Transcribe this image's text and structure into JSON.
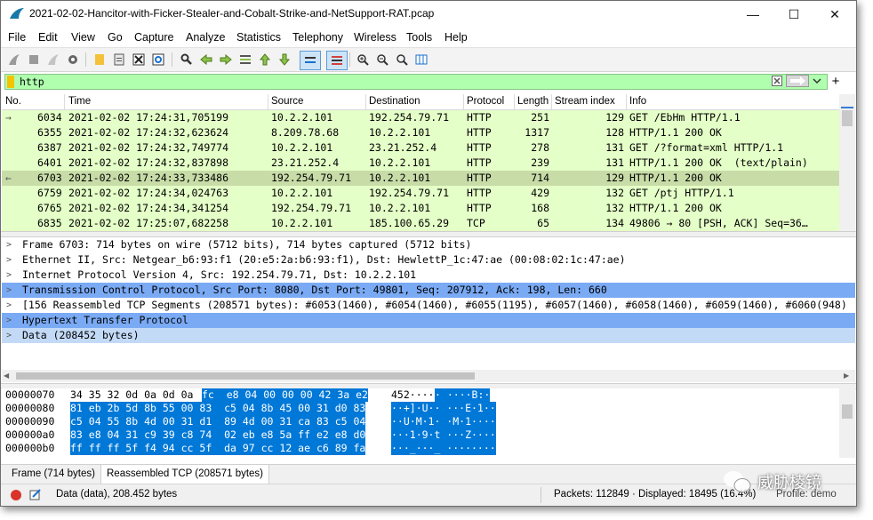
{
  "window": {
    "title": "2021-02-02-Hancitor-with-Ficker-Stealer-and-Cobalt-Strike-and-NetSupport-RAT.pcap",
    "minimize": "—",
    "maximize": "☐",
    "close": "✕"
  },
  "menu": [
    "File",
    "Edit",
    "View",
    "Go",
    "Capture",
    "Analyze",
    "Statistics",
    "Telephony",
    "Wireless",
    "Tools",
    "Help"
  ],
  "filter": {
    "value": "http",
    "plus": "+"
  },
  "columns": [
    "No.",
    "Time",
    "Source",
    "Destination",
    "Protocol",
    "Length",
    "Stream index",
    "Info"
  ],
  "packets": [
    {
      "no": "6034",
      "time": "2021-02-02 17:24:31,705199",
      "src": "10.2.2.101",
      "dst": "192.254.79.71",
      "proto": "HTTP",
      "len": "251",
      "stream": "129",
      "info": "GET /EbHm HTTP/1.1",
      "bg": "#e4ffc7",
      "marker": "→"
    },
    {
      "no": "6355",
      "time": "2021-02-02 17:24:32,623624",
      "src": "8.209.78.68",
      "dst": "10.2.2.101",
      "proto": "HTTP",
      "len": "1317",
      "stream": "128",
      "info": "HTTP/1.1 200 OK",
      "bg": "#e4ffc7",
      "marker": ""
    },
    {
      "no": "6387",
      "time": "2021-02-02 17:24:32,749774",
      "src": "10.2.2.101",
      "dst": "23.21.252.4",
      "proto": "HTTP",
      "len": "278",
      "stream": "131",
      "info": "GET /?format=xml HTTP/1.1",
      "bg": "#e4ffc7",
      "marker": ""
    },
    {
      "no": "6401",
      "time": "2021-02-02 17:24:32,837898",
      "src": "23.21.252.4",
      "dst": "10.2.2.101",
      "proto": "HTTP",
      "len": "239",
      "stream": "131",
      "info": "HTTP/1.1 200 OK  (text/plain)",
      "bg": "#e4ffc7",
      "marker": ""
    },
    {
      "no": "6703",
      "time": "2021-02-02 17:24:33,733486",
      "src": "192.254.79.71",
      "dst": "10.2.2.101",
      "proto": "HTTP",
      "len": "714",
      "stream": "129",
      "info": "HTTP/1.1 200 OK",
      "bg": "#c8dca8",
      "marker": "←"
    },
    {
      "no": "6759",
      "time": "2021-02-02 17:24:34,024763",
      "src": "10.2.2.101",
      "dst": "192.254.79.71",
      "proto": "HTTP",
      "len": "429",
      "stream": "132",
      "info": "GET /ptj HTTP/1.1",
      "bg": "#e4ffc7",
      "marker": ""
    },
    {
      "no": "6765",
      "time": "2021-02-02 17:24:34,341254",
      "src": "192.254.79.71",
      "dst": "10.2.2.101",
      "proto": "HTTP",
      "len": "168",
      "stream": "132",
      "info": "HTTP/1.1 200 OK",
      "bg": "#e4ffc7",
      "marker": ""
    },
    {
      "no": "6835",
      "time": "2021-02-02 17:25:07,682258",
      "src": "10.2.2.101",
      "dst": "185.100.65.29",
      "proto": "TCP",
      "len": "65",
      "stream": "134",
      "info": "49806 → 80 [PSH, ACK] Seq=36…",
      "bg": "#e4ffc7",
      "marker": ""
    }
  ],
  "details": [
    {
      "text": "Frame 6703: 714 bytes on wire (5712 bits), 714 bytes captured (5712 bits)",
      "bg": "#ffffff"
    },
    {
      "text": "Ethernet II, Src: Netgear_b6:93:f1 (20:e5:2a:b6:93:f1), Dst: HewlettP_1c:47:ae (00:08:02:1c:47:ae)",
      "bg": "#ffffff"
    },
    {
      "text": "Internet Protocol Version 4, Src: 192.254.79.71, Dst: 10.2.2.101",
      "bg": "#ffffff"
    },
    {
      "text": "Transmission Control Protocol, Src Port: 8080, Dst Port: 49801, Seq: 207912, Ack: 198, Len: 660",
      "bg": "#7aaaf4"
    },
    {
      "text": "[156 Reassembled TCP Segments (208571 bytes): #6053(1460), #6054(1460), #6055(1195), #6057(1460), #6058(1460), #6059(1460), #6060(948)",
      "bg": "#ffffff"
    },
    {
      "text": "Hypertext Transfer Protocol",
      "bg": "#7aaaf4"
    },
    {
      "text": "Data (208452 bytes)",
      "bg": "#c3daf7"
    }
  ],
  "bytes": [
    {
      "offset": "00000070",
      "pre": "34 35 32 0d 0a 0d 0a",
      "hex": "fc  e8 04 00 00 00 42 3a e2",
      "apre": "452····",
      "ascii": "· ····B:·"
    },
    {
      "offset": "00000080",
      "pre": "",
      "hex": "81 eb 2b 5d 8b 55 00 83  c5 04 8b 45 00 31 d0 83",
      "apre": "",
      "ascii": "··+]·U·· ···E·1··"
    },
    {
      "offset": "00000090",
      "pre": "",
      "hex": "c5 04 55 8b 4d 00 31 d1  89 4d 00 31 ca 83 c5 04",
      "apre": "",
      "ascii": "··U·M·1· ·M·1····"
    },
    {
      "offset": "000000a0",
      "pre": "",
      "hex": "83 e8 04 31 c9 39 c8 74  02 eb e8 5a ff e2 e8 d0",
      "apre": "",
      "ascii": "···1·9·t ···Z····"
    },
    {
      "offset": "000000b0",
      "pre": "",
      "hex": "ff ff ff 5f f4 94 cc 5f  da 97 cc 12 ae c6 89 fa",
      "apre": "",
      "ascii": "···_···_ ········"
    }
  ],
  "tabs": [
    "Frame (714 bytes)",
    "Reassembled TCP (208571 bytes)"
  ],
  "status": {
    "field": "Data (data), 208.452 bytes",
    "counts": "Packets: 112849 · Displayed: 18495 (16.4%)",
    "profile": "Profile: demo"
  },
  "watermark": "威胁棱镜"
}
